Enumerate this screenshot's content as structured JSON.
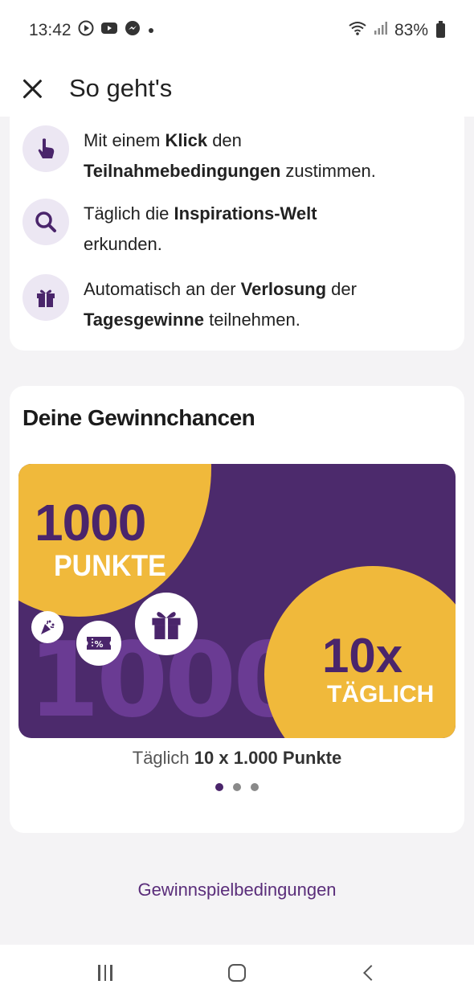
{
  "status_bar": {
    "time": "13:42",
    "battery": "83%",
    "icons": [
      "play-icon",
      "youtube-icon",
      "messenger-icon",
      "dot-icon",
      "wifi-icon",
      "signal-icon",
      "battery-icon"
    ]
  },
  "header": {
    "title": "So geht's",
    "close_icon": "close-icon"
  },
  "steps": [
    {
      "icon": "pointer-hand-icon",
      "parts": [
        "Mit einem ",
        "Klick",
        " den",
        "Teilnahmebedingungen",
        " zustimmen."
      ]
    },
    {
      "icon": "magnifier-icon",
      "parts": [
        "Täglich die ",
        "Inspirations-Welt",
        "erkunden."
      ]
    },
    {
      "icon": "gift-icon",
      "parts": [
        "Automatisch an der ",
        "Verlosung",
        " der",
        "Tagesgewinne",
        " teilnehmen."
      ]
    }
  ],
  "win_card": {
    "title": "Deine Gewinnchancen",
    "banner": {
      "points_number": "1000",
      "points_label": "PUNKTE",
      "bg_number": "1000",
      "times_number": "10x",
      "times_label": "TÄGLICH",
      "icons": [
        "gift-icon",
        "coupon-percent-icon",
        "party-popper-icon"
      ]
    },
    "caption_prefix": "Täglich ",
    "caption_bold": "10 x 1.000 Punkte",
    "carousel_total": 3,
    "carousel_active": 1
  },
  "terms_link": "Gewinnspielbedingungen",
  "nav_bar": {
    "buttons": [
      "recents-icon",
      "home-icon",
      "back-icon"
    ]
  },
  "colors": {
    "purple": "#4c2a6c",
    "yellow": "#f0b93b",
    "link": "#5a2d7a",
    "icon_bg": "#ece7f3"
  }
}
